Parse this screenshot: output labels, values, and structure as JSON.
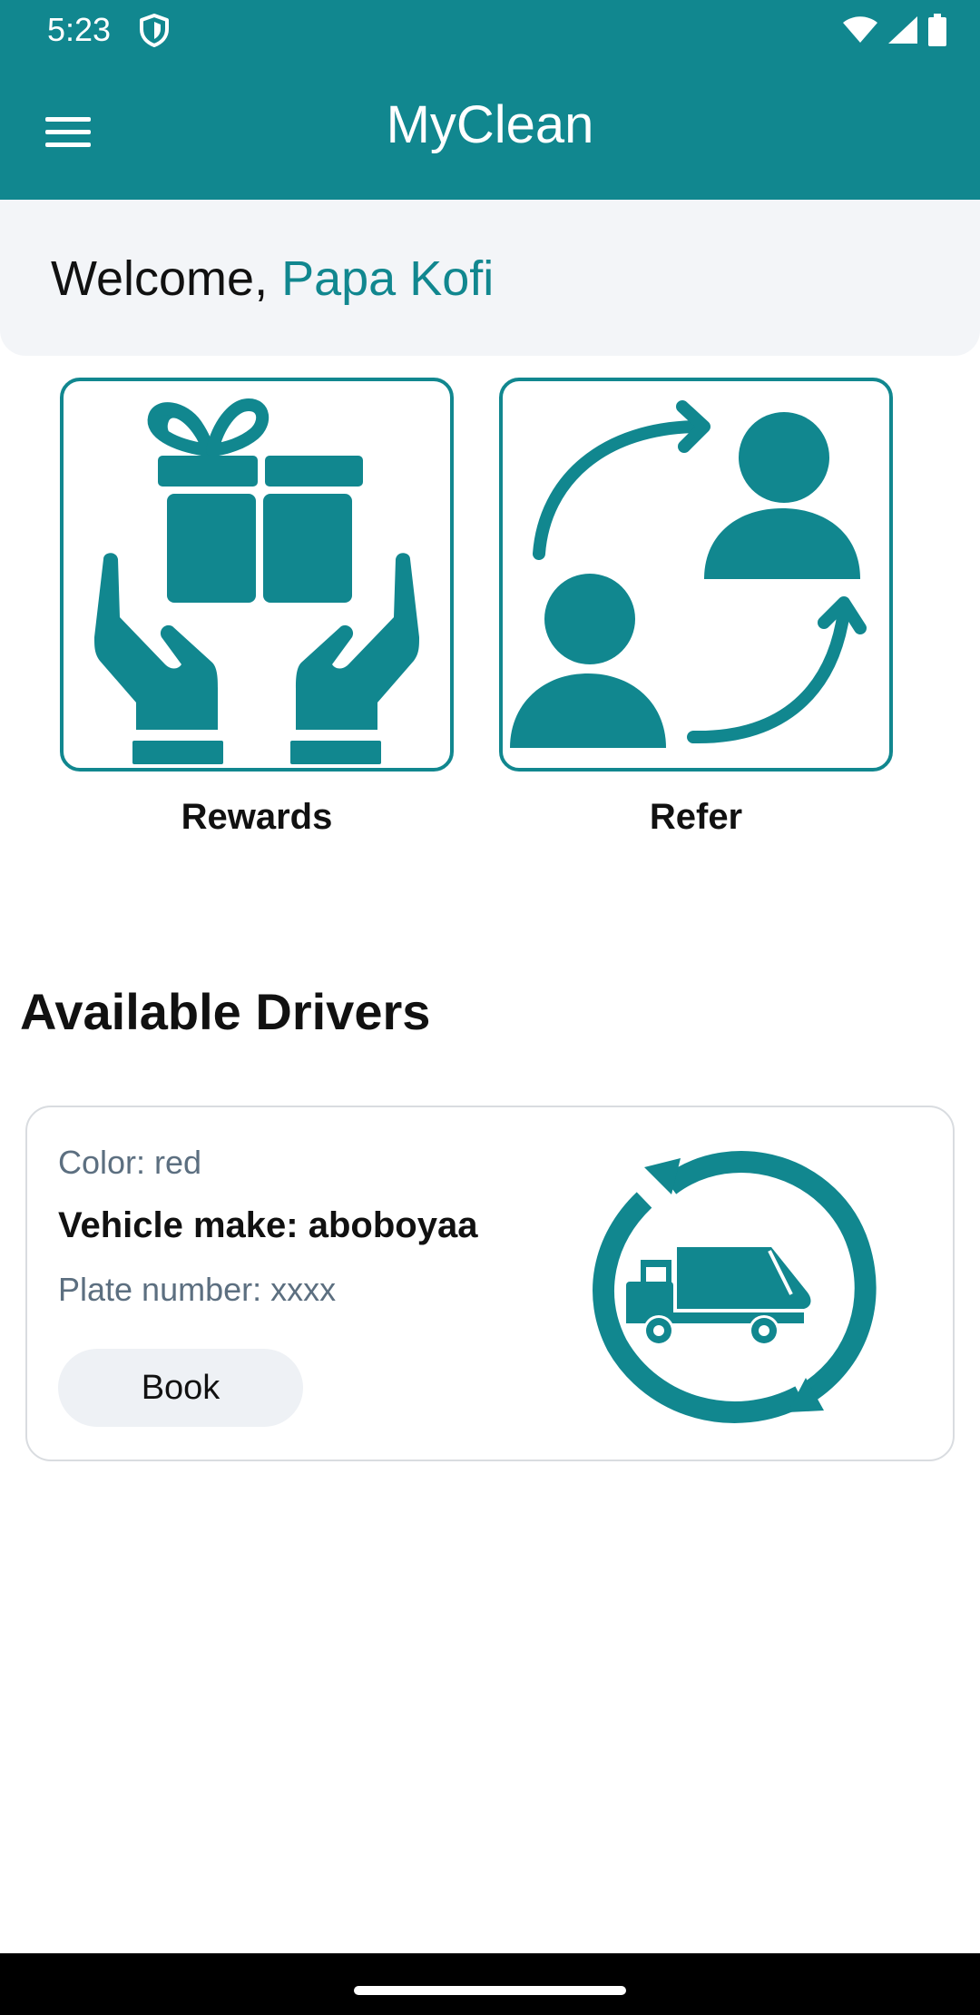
{
  "status_bar": {
    "time": "5:23"
  },
  "app_bar": {
    "title": "MyClean"
  },
  "welcome": {
    "greeting": "Welcome, ",
    "user_name": "Papa Kofi"
  },
  "tiles": [
    {
      "label": "Rewards",
      "icon": "gift-in-hands-icon"
    },
    {
      "label": "Refer",
      "icon": "refer-people-icon"
    }
  ],
  "drivers_section": {
    "title": "Available Drivers"
  },
  "drivers": [
    {
      "color_text": "Color: red",
      "make_text": "Vehicle make: aboboyaa",
      "plate_text": "Plate number: xxxx",
      "book_label": "Book",
      "icon": "garbage-truck-recycle-icon"
    }
  ],
  "colors": {
    "primary": "#11878f",
    "welcome_bg": "#f3f5f8",
    "secondary_text": "#5c6f80",
    "button_bg": "#eef1f5"
  }
}
